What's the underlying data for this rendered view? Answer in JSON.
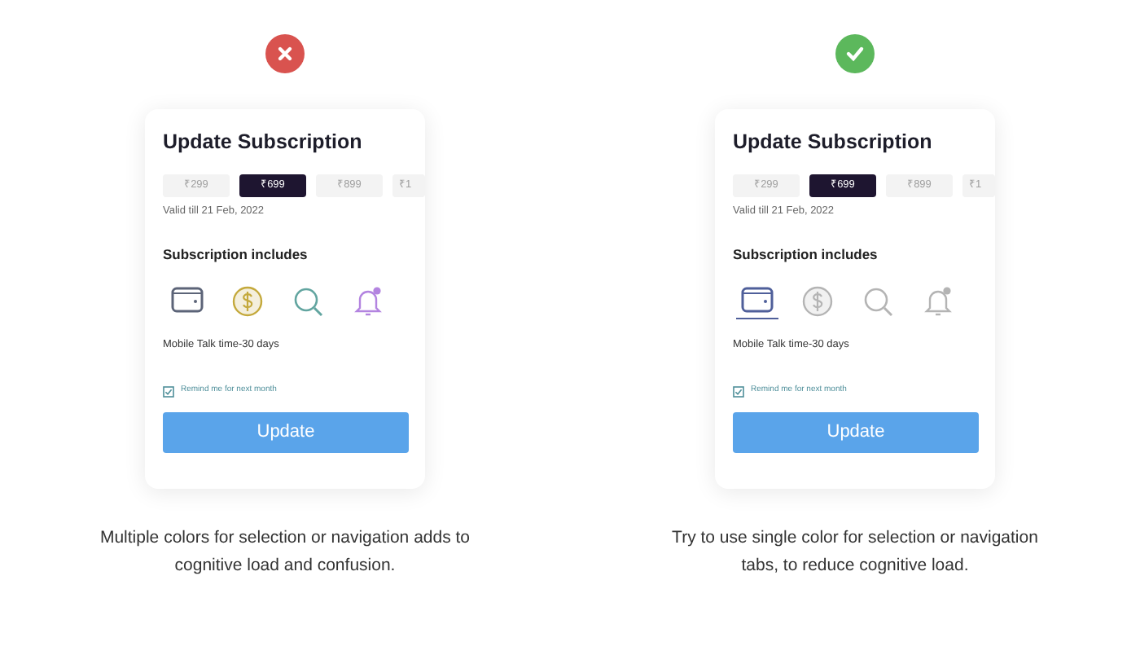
{
  "panels": [
    {
      "verdict": {
        "kind": "wrong"
      },
      "card": {
        "title": "Update Subscription",
        "prices": [
          {
            "label": "₹299",
            "selected": false
          },
          {
            "label": "₹699",
            "selected": true
          },
          {
            "label": "₹899",
            "selected": false
          },
          {
            "label": "₹1",
            "selected": false
          }
        ],
        "validity": "Valid till 21 Feb, 2022",
        "section_title": "Subscription includes",
        "features": [
          {
            "kind": "wallet",
            "selected": false,
            "color": "#5c6478"
          },
          {
            "kind": "dollar",
            "selected": false,
            "color": "#c4a93c"
          },
          {
            "kind": "search",
            "selected": false,
            "color": "#62a5a0"
          },
          {
            "kind": "bell",
            "selected": false,
            "color": "#b384e0"
          }
        ],
        "feature_text": "Mobile Talk time-30 days",
        "reminder": {
          "label": "Remind me for next month",
          "checked": true
        },
        "button": "Update"
      },
      "caption": "Multiple colors for selection or navigation adds to cognitive load and confusion."
    },
    {
      "verdict": {
        "kind": "right"
      },
      "card": {
        "title": "Update Subscription",
        "prices": [
          {
            "label": "₹299",
            "selected": false
          },
          {
            "label": "₹699",
            "selected": true
          },
          {
            "label": "₹899",
            "selected": false
          },
          {
            "label": "₹1",
            "selected": false
          }
        ],
        "validity": "Valid till 21 Feb, 2022",
        "section_title": "Subscription includes",
        "features": [
          {
            "kind": "wallet",
            "selected": true,
            "color": "#4f5f9a"
          },
          {
            "kind": "dollar",
            "selected": false,
            "color": "#b4b4b4"
          },
          {
            "kind": "search",
            "selected": false,
            "color": "#b4b4b4"
          },
          {
            "kind": "bell",
            "selected": false,
            "color": "#b4b4b4"
          }
        ],
        "feature_text": "Mobile Talk time-30 days",
        "reminder": {
          "label": "Remind me for next month",
          "checked": true
        },
        "button": "Update"
      },
      "caption": "Try to use single color for selection or navigation tabs, to reduce cognitive load."
    }
  ]
}
